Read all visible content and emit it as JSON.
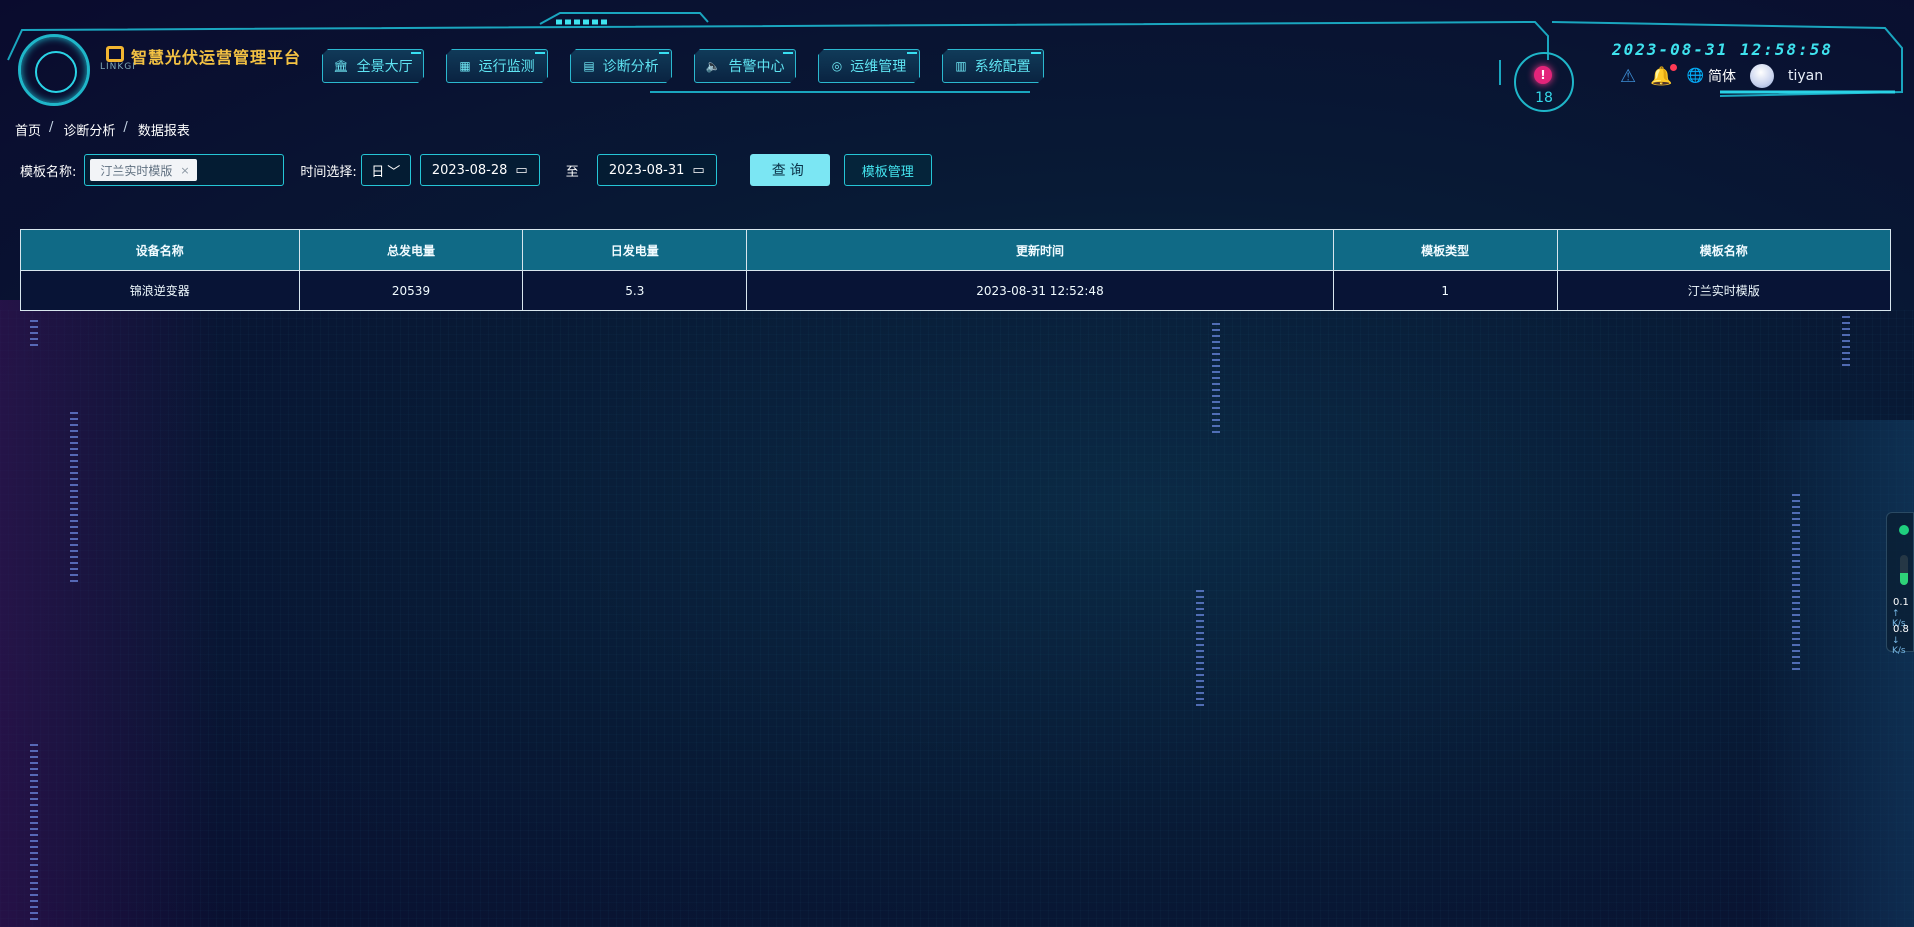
{
  "brand": {
    "title": "智慧光伏运营管理平台",
    "sub": "LINKGI"
  },
  "nav": [
    {
      "icon": "🏛",
      "label": "全景大厅"
    },
    {
      "icon": "▦",
      "label": "运行监测"
    },
    {
      "icon": "▤",
      "label": "诊断分析"
    },
    {
      "icon": "🔈",
      "label": "告警中心"
    },
    {
      "icon": "◎",
      "label": "运维管理"
    },
    {
      "icon": "▥",
      "label": "系统配置"
    }
  ],
  "alarm": {
    "badge": "!",
    "count": "18"
  },
  "header": {
    "datetime": "2023-08-31 12:58:58",
    "lang": "简体",
    "user": "tiyan"
  },
  "breadcrumb": [
    "首页",
    "诊断分析",
    "数据报表"
  ],
  "filters": {
    "template_label": "模板名称:",
    "template_tag": "汀兰实时模版",
    "time_label": "时间选择:",
    "period": "日",
    "start_date": "2023-08-28",
    "to_label": "至",
    "end_date": "2023-08-31",
    "query_button": "查询",
    "template_manage_button": "模板管理"
  },
  "table": {
    "columns": [
      "设备名称",
      "总发电量",
      "日发电量",
      "更新时间",
      "模板类型",
      "模板名称"
    ],
    "rows": [
      [
        "锦浪逆变器",
        "20539",
        "5.3",
        "2023-08-31 12:52:48",
        "1",
        "汀兰实时模版"
      ]
    ]
  },
  "net_widget": {
    "up_value": "0.1",
    "up_unit": "↑ K/s",
    "down_value": "0.8",
    "down_unit": "↓ K/s"
  },
  "colors": {
    "accent": "#25c5d6",
    "brand": "#f4c243",
    "alarm": "#e3247a",
    "table_header": "#106a86"
  }
}
